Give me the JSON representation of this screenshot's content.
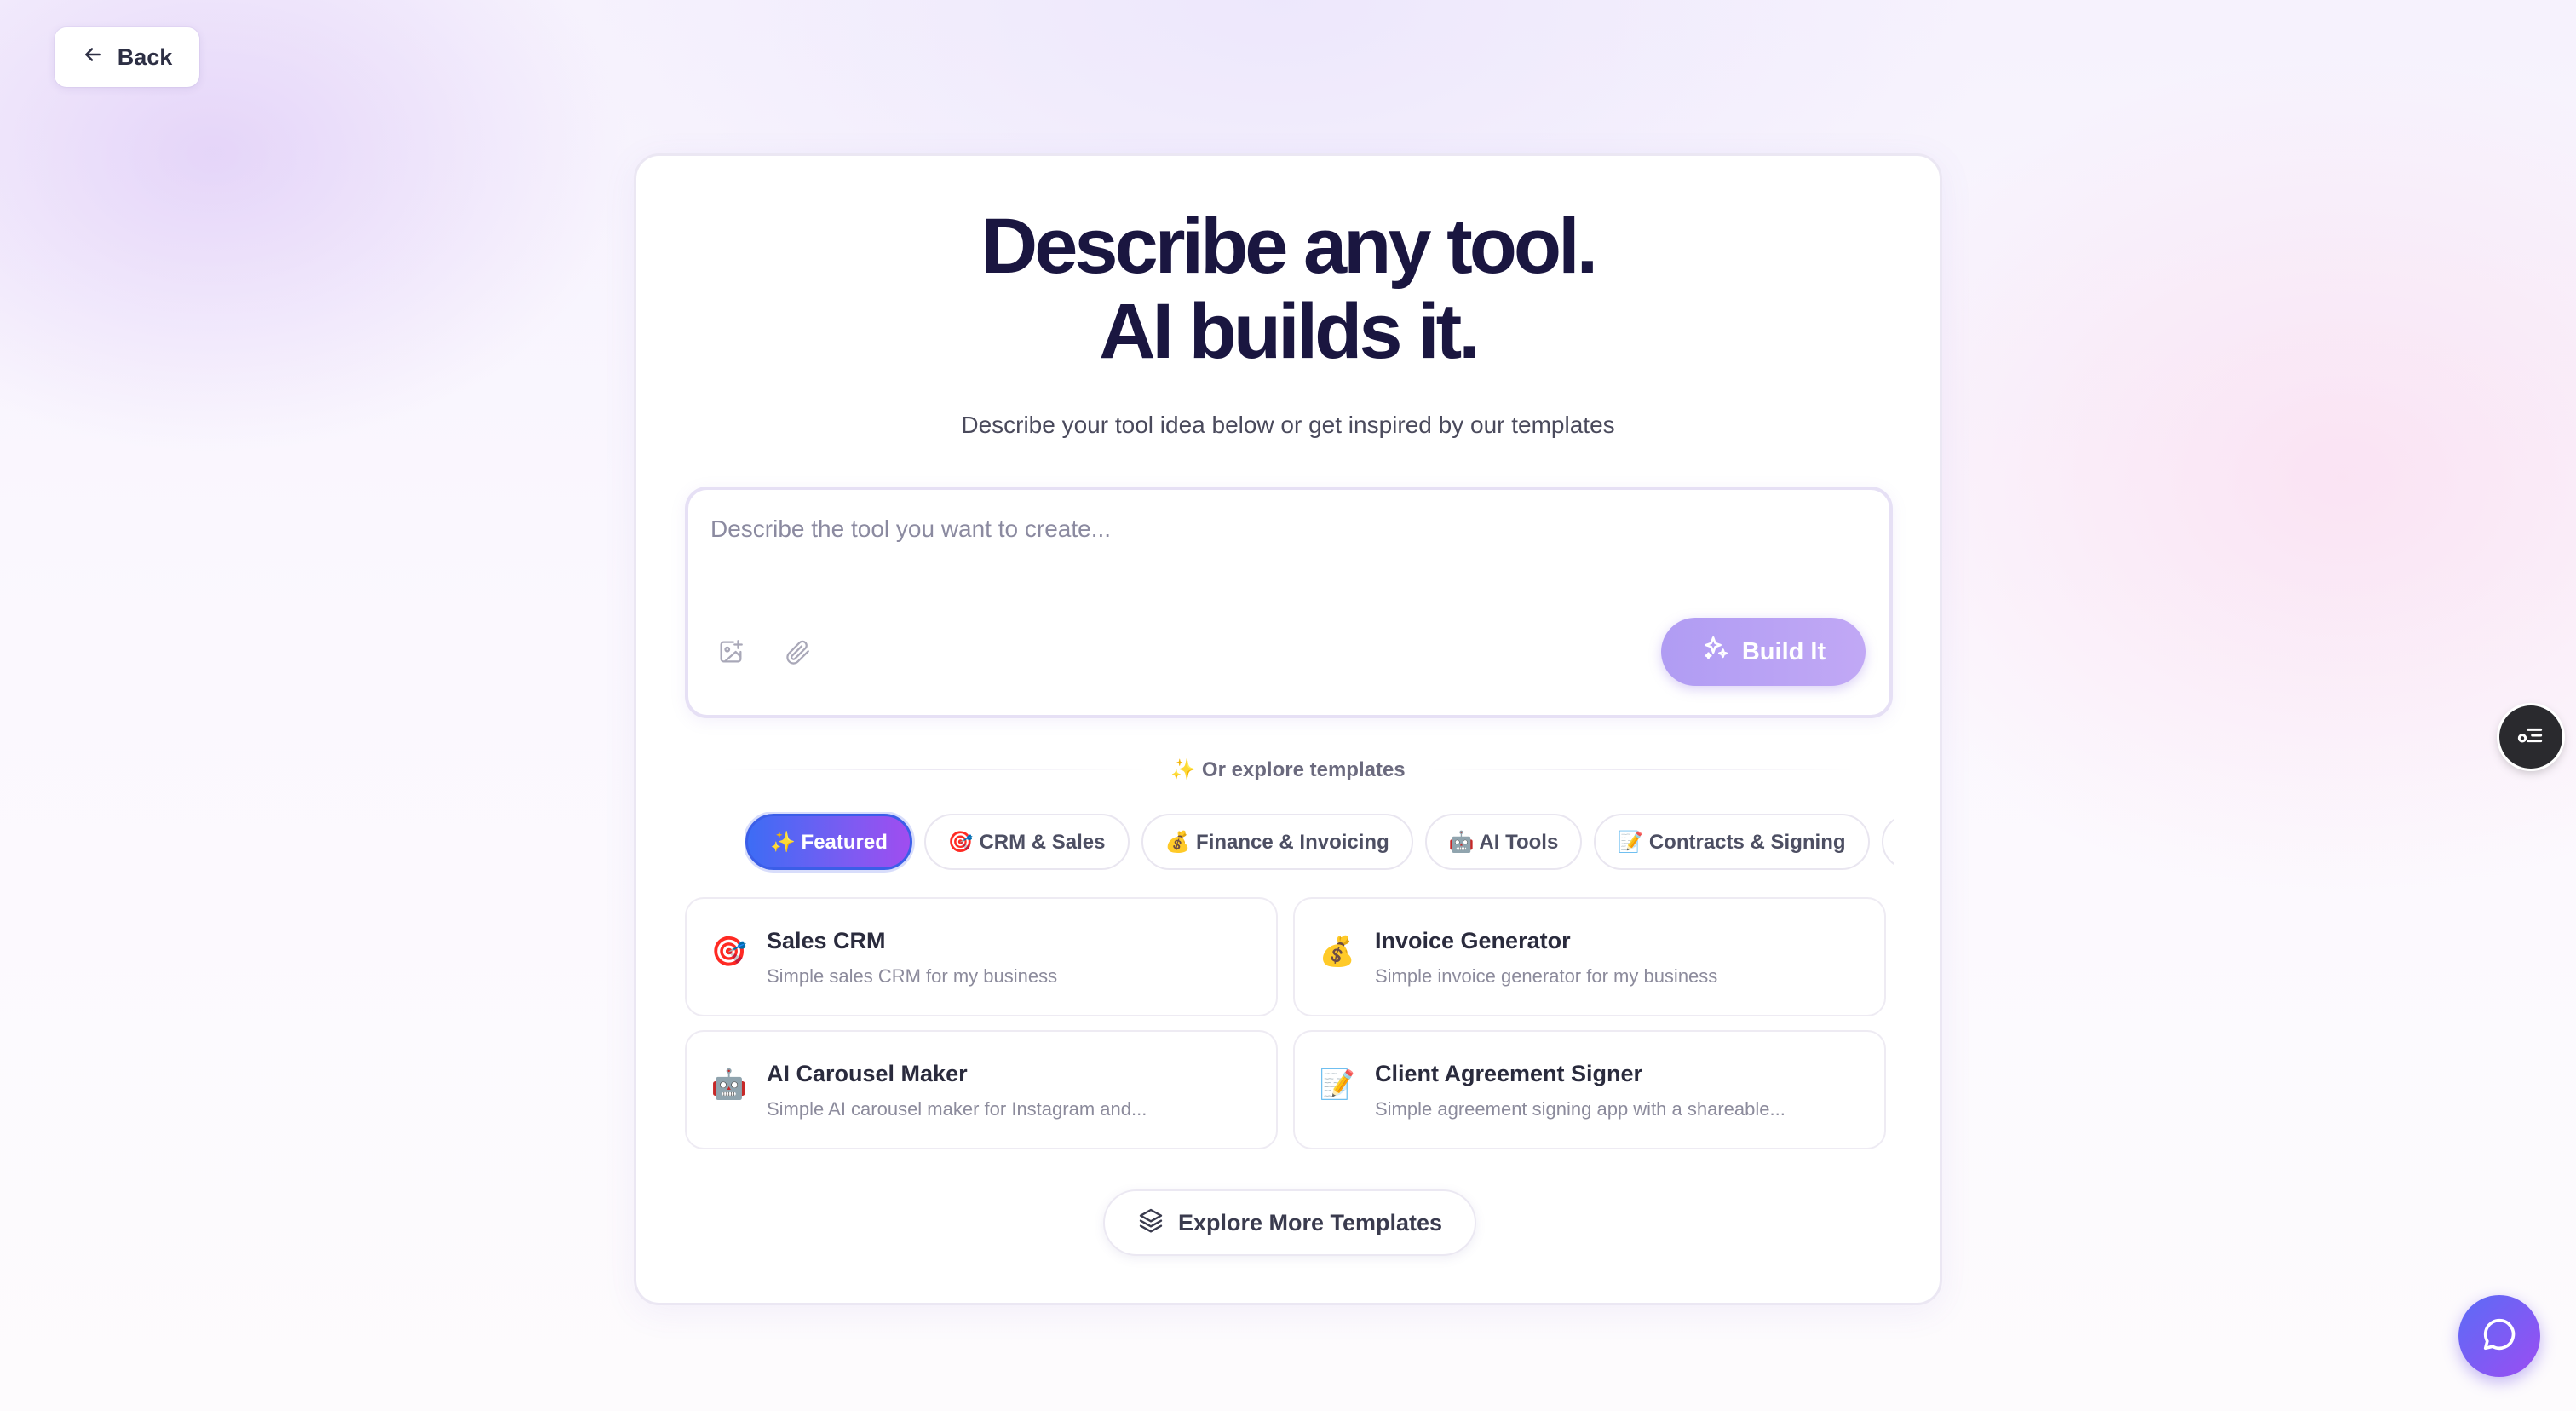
{
  "back": {
    "label": "Back"
  },
  "hero": {
    "line1": "Describe any tool.",
    "line2": "AI builds it.",
    "subtitle": "Describe your tool idea below or get inspired by our templates"
  },
  "prompt": {
    "placeholder": "Describe the tool you want to create...",
    "value": "",
    "build_label": "Build It"
  },
  "divider": {
    "label": "✨ Or explore templates"
  },
  "tabs": [
    {
      "label": "✨ Featured",
      "active": true
    },
    {
      "label": "🎯 CRM & Sales"
    },
    {
      "label": "💰 Finance & Invoicing"
    },
    {
      "label": "🤖 AI Tools"
    },
    {
      "label": "📝 Contracts & Signing"
    },
    {
      "label": "⚡"
    }
  ],
  "templates": [
    {
      "emoji": "🎯",
      "title": "Sales CRM",
      "description": "Simple sales CRM for my business"
    },
    {
      "emoji": "💰",
      "title": "Invoice Generator",
      "description": "Simple invoice generator for my business"
    },
    {
      "emoji": "🤖",
      "title": "AI Carousel Maker",
      "description": "Simple AI carousel maker for Instagram and..."
    },
    {
      "emoji": "📝",
      "title": "Client Agreement Signer",
      "description": "Simple agreement signing app with a shareable..."
    }
  ],
  "explore": {
    "label": "Explore More Templates"
  },
  "icons": {
    "back": "arrow-left-icon",
    "image_upload": "image-plus-icon",
    "attach": "paperclip-icon",
    "build": "sparkles-icon",
    "explore": "layers-icon",
    "settings_float": "toggle-list-icon",
    "chat": "chat-bubble-icon"
  },
  "colors": {
    "heading": "#1a1640",
    "build_button": "#b09cf3",
    "tab_active_start": "#3d6cf5",
    "tab_active_end": "#a04df0",
    "chat_button": "#7a5cf2"
  }
}
